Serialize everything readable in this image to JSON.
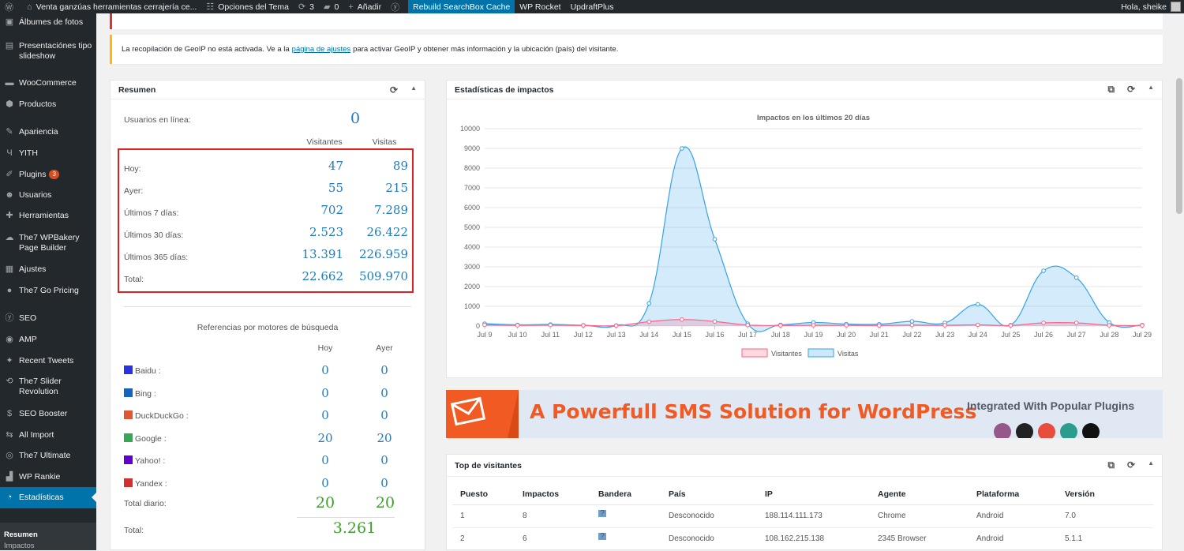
{
  "adminbar": {
    "site": "Venta ganzúas herramientas cerrajería ce...",
    "theme_options": "Opciones del Tema",
    "updates": "3",
    "comments": "0",
    "add": "Añadir",
    "rebuild": "Rebuild SearchBox Cache",
    "wp_rocket": "WP Rocket",
    "updraft": "UpdraftPlus",
    "greeting": "Hola, sheike"
  },
  "sidebar": {
    "items": [
      {
        "label": "Álbumes de fotos",
        "icon": "gallery-icon"
      },
      {
        "label": "Presentaciónes tipo slideshow",
        "icon": "slideshow-icon"
      },
      {
        "label": "WooCommerce",
        "icon": "woocommerce-icon"
      },
      {
        "label": "Productos",
        "icon": "product-box-icon"
      },
      {
        "label": "Apariencia",
        "icon": "paintbrush-icon"
      },
      {
        "label": "YITH",
        "icon": "yith-icon"
      },
      {
        "label": "Plugins",
        "icon": "plugin-icon",
        "badge": "3"
      },
      {
        "label": "Usuarios",
        "icon": "users-icon"
      },
      {
        "label": "Herramientas",
        "icon": "wrench-icon"
      },
      {
        "label": "The7 WPBakery Page Builder",
        "icon": "cloud-icon"
      },
      {
        "label": "Ajustes",
        "icon": "settings-grid-icon"
      },
      {
        "label": "The7 Go Pricing",
        "icon": "pricing-icon"
      },
      {
        "label": "SEO",
        "icon": "yoast-icon"
      },
      {
        "label": "AMP",
        "icon": "amp-icon"
      },
      {
        "label": "Recent Tweets",
        "icon": "twitter-icon"
      },
      {
        "label": "The7 Slider Revolution",
        "icon": "refresh-icon"
      },
      {
        "label": "SEO Booster",
        "icon": "dollar-icon"
      },
      {
        "label": "All Import",
        "icon": "import-icon"
      },
      {
        "label": "The7 Ultimate",
        "icon": "shield-check-icon"
      },
      {
        "label": "WP Rankie",
        "icon": "chart-icon"
      },
      {
        "label": "Estadísticas",
        "icon": "pie-chart-icon"
      }
    ],
    "submenu": [
      "Resumen",
      "Impactos"
    ]
  },
  "notice": {
    "before": "La recopilación de GeoIP no está activada. Ve a la",
    "link": "página de ajustes",
    "after": "para activar GeoIP y obtener más información y la ubicación (país) del visitante."
  },
  "resumen": {
    "title": "Resumen",
    "online_label": "Usuarios en línea:",
    "online_value": "0",
    "col_visitors": "Visitantes",
    "col_visits": "Visitas",
    "rows": [
      {
        "label": "Hoy:",
        "visitors": "47",
        "visits": "89"
      },
      {
        "label": "Ayer:",
        "visitors": "55",
        "visits": "215"
      },
      {
        "label": "Últimos 7 días:",
        "visitors": "702",
        "visits": "7.289"
      },
      {
        "label": "Últimos 30 días:",
        "visitors": "2.523",
        "visits": "26.422"
      },
      {
        "label": "Últimos 365 días:",
        "visitors": "13.391",
        "visits": "226.959"
      },
      {
        "label": "Total:",
        "visitors": "22.662",
        "visits": "509.970"
      }
    ],
    "search_title": "Referencias por motores de búsqueda",
    "col_today": "Hoy",
    "col_yesterday": "Ayer",
    "engines": [
      {
        "name": "Baidu :",
        "today": "0",
        "yesterday": "0",
        "color": "#2932e1"
      },
      {
        "name": "Bing :",
        "today": "0",
        "yesterday": "0",
        "color": "#1565c0"
      },
      {
        "name": "DuckDuckGo :",
        "today": "0",
        "yesterday": "0",
        "color": "#de5833"
      },
      {
        "name": "Google :",
        "today": "20",
        "yesterday": "20",
        "color": "#34a853"
      },
      {
        "name": "Yahoo! :",
        "today": "0",
        "yesterday": "0",
        "color": "#6001d2"
      },
      {
        "name": "Yandex :",
        "today": "0",
        "yesterday": "0",
        "color": "#d32f2f"
      }
    ],
    "daily_label": "Total diario:",
    "daily_today": "20",
    "daily_yesterday": "20",
    "total_label": "Total:",
    "total_value": "3.261"
  },
  "hits": {
    "title": "Estadísticas de impactos"
  },
  "chart_data": {
    "type": "area",
    "title": "Impactos en los últimos 20 días",
    "categories": [
      "Jul 9",
      "Jul 10",
      "Jul 11",
      "Jul 12",
      "Jul 13",
      "Jul 14",
      "Jul 15",
      "Jul 16",
      "Jul 17",
      "Jul 18",
      "Jul 19",
      "Jul 20",
      "Jul 21",
      "Jul 22",
      "Jul 23",
      "Jul 24",
      "Jul 25",
      "Jul 26",
      "Jul 27",
      "Jul 28",
      "Jul 29"
    ],
    "ylim": [
      0,
      10000
    ],
    "yticks": [
      0,
      1000,
      2000,
      3000,
      4000,
      5000,
      6000,
      7000,
      8000,
      9000,
      10000
    ],
    "grid": true,
    "legend": "bottom",
    "series": [
      {
        "name": "Visitantes",
        "color": "#ff6384",
        "values": [
          60,
          40,
          50,
          30,
          20,
          220,
          330,
          230,
          50,
          30,
          40,
          40,
          30,
          50,
          40,
          60,
          30,
          160,
          160,
          40,
          30
        ]
      },
      {
        "name": "Visitas",
        "color": "#36a2eb",
        "values": [
          120,
          60,
          80,
          40,
          30,
          1150,
          9000,
          4400,
          120,
          60,
          180,
          100,
          90,
          240,
          160,
          1100,
          50,
          2800,
          2450,
          180,
          50
        ]
      }
    ]
  },
  "banner": {
    "headline": "A Powerfull SMS Solution for WordPress",
    "side": "Integrated With Popular Plugins"
  },
  "top_visitors": {
    "title": "Top de visitantes",
    "headers": [
      "Puesto",
      "Impactos",
      "Bandera",
      "País",
      "IP",
      "Agente",
      "Plataforma",
      "Versión"
    ],
    "rows": [
      {
        "rank": "1",
        "hits": "8",
        "flag": "?",
        "country": "Desconocido",
        "ip": "188.114.111.173",
        "agent": "Chrome",
        "platform": "Android",
        "version": "7.0"
      },
      {
        "rank": "2",
        "hits": "6",
        "flag": "?",
        "country": "Desconocido",
        "ip": "108.162.215.138",
        "agent": "2345 Browser",
        "platform": "Android",
        "version": "5.1.1"
      }
    ]
  }
}
